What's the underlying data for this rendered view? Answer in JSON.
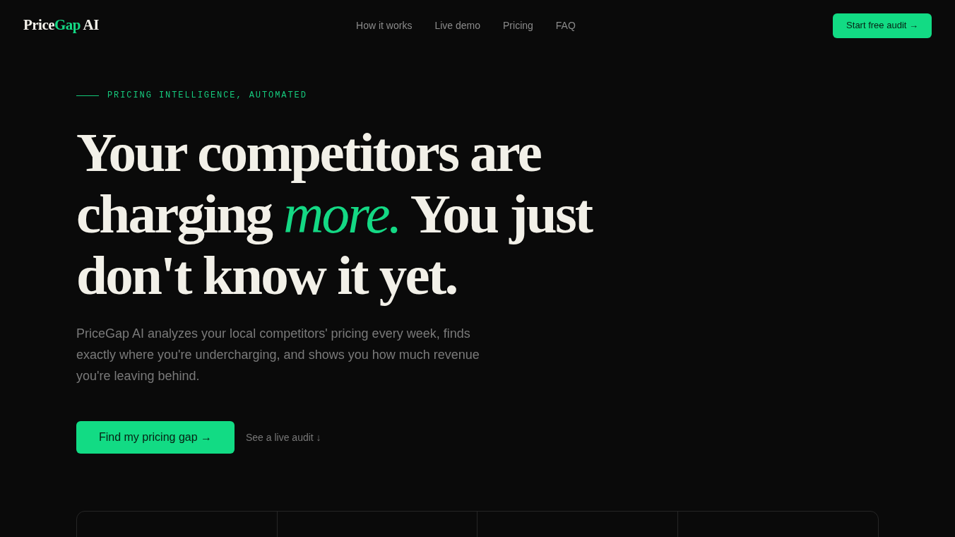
{
  "header": {
    "logo": {
      "parts": [
        {
          "text": "Price",
          "accent": false
        },
        {
          "text": "Gap",
          "accent": true
        },
        {
          "text": " AI",
          "accent": false
        }
      ]
    },
    "nav": [
      {
        "label": "How it works"
      },
      {
        "label": "Live demo"
      },
      {
        "label": "Pricing"
      },
      {
        "label": "FAQ"
      }
    ],
    "cta": "Start free audit →"
  },
  "hero": {
    "eyebrow": "PRICING INTELLIGENCE, AUTOMATED",
    "headline": "Your competitors are charging *more.* You just don't know it yet.",
    "description": "PriceGap AI analyzes your local competitors' pricing every week, finds exactly where you're undercharging, and shows you how much revenue you're leaving behind.",
    "primary_button": "Find my pricing gap →",
    "secondary_link": "See a live audit ↓"
  }
}
